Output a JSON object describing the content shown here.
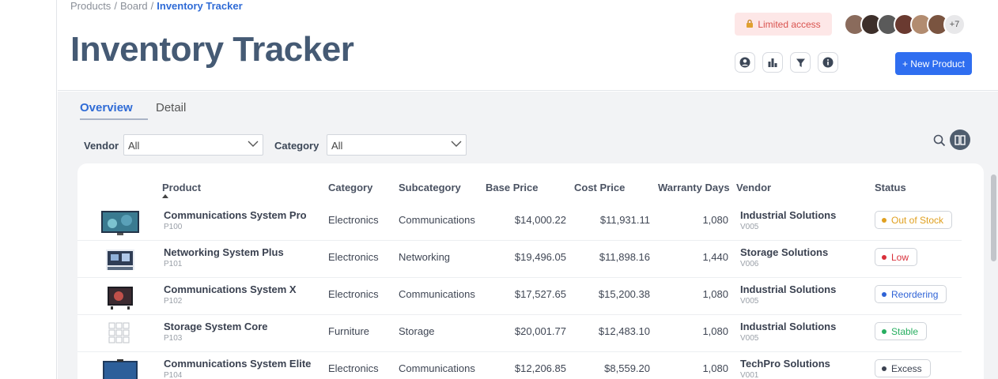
{
  "breadcrumb": {
    "items": [
      "Products",
      "Board"
    ],
    "current": "Inventory Tracker"
  },
  "page": {
    "title": "Inventory Tracker"
  },
  "access": {
    "label": "Limited access"
  },
  "avatars": {
    "more_label": "+7",
    "colors": [
      "#8a6b5c",
      "#3d2f2a",
      "#5a5a5a",
      "#6a3a30",
      "#b28c70",
      "#7a5440"
    ]
  },
  "toolbar": {
    "icons": [
      "user-circle-icon",
      "bar-chart-icon",
      "filter-icon",
      "info-icon"
    ],
    "new_button_label": "+ New Product"
  },
  "tabs": [
    {
      "label": "Overview",
      "active": true
    },
    {
      "label": "Detail",
      "active": false
    }
  ],
  "filters": {
    "vendor": {
      "label": "Vendor",
      "value": "All"
    },
    "category": {
      "label": "Category",
      "value": "All"
    }
  },
  "table": {
    "columns": [
      "Product",
      "Category",
      "Subcategory",
      "Base Price",
      "Cost Price",
      "Warranty Days",
      "Vendor",
      "Status"
    ],
    "rows": [
      {
        "name": "Communications System Pro",
        "id": "P100",
        "category": "Electronics",
        "subcategory": "Communications",
        "base": "$14,000.22",
        "cost": "$11,931.11",
        "warranty": "1,080",
        "vendor": "Industrial Solutions",
        "vendor_id": "V005",
        "status": "Out of Stock",
        "status_color": "#e0a020"
      },
      {
        "name": "Networking System Plus",
        "id": "P101",
        "category": "Electronics",
        "subcategory": "Networking",
        "base": "$19,496.05",
        "cost": "$11,898.16",
        "warranty": "1,440",
        "vendor": "Storage Solutions",
        "vendor_id": "V006",
        "status": "Low",
        "status_color": "#d9303a"
      },
      {
        "name": "Communications System X",
        "id": "P102",
        "category": "Electronics",
        "subcategory": "Communications",
        "base": "$17,527.65",
        "cost": "$15,200.38",
        "warranty": "1,080",
        "vendor": "Industrial Solutions",
        "vendor_id": "V005",
        "status": "Reordering",
        "status_color": "#2f63d6"
      },
      {
        "name": "Storage System Core",
        "id": "P103",
        "category": "Furniture",
        "subcategory": "Storage",
        "base": "$20,001.77",
        "cost": "$12,483.10",
        "warranty": "1,080",
        "vendor": "Industrial Solutions",
        "vendor_id": "V005",
        "status": "Stable",
        "status_color": "#27ae60"
      },
      {
        "name": "Communications System Elite",
        "id": "P104",
        "category": "Electronics",
        "subcategory": "Communications",
        "base": "$12,206.85",
        "cost": "$8,559.20",
        "warranty": "1,080",
        "vendor": "TechPro Solutions",
        "vendor_id": "V001",
        "status": "Excess",
        "status_color": "#3a4150"
      }
    ]
  }
}
